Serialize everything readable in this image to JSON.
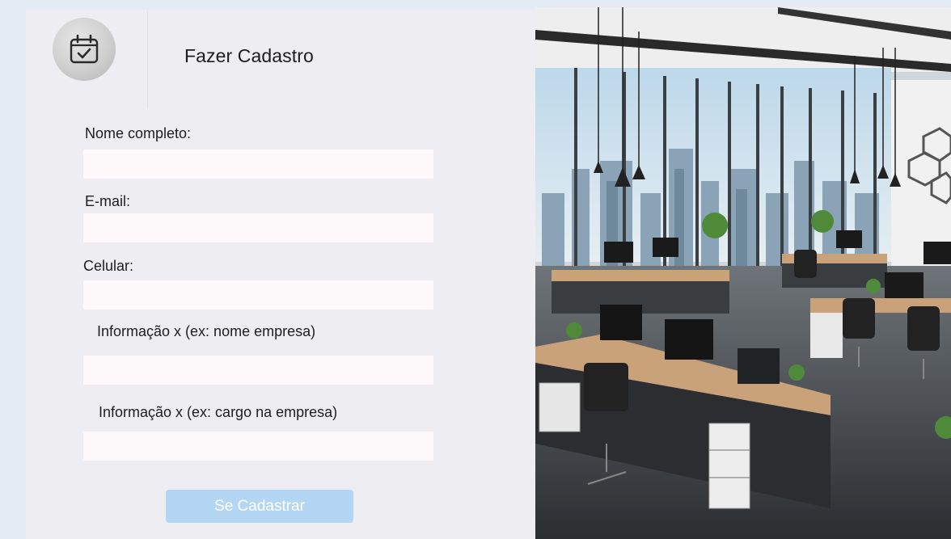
{
  "form": {
    "title": "Fazer Cadastro",
    "logo_icon": "calendar-check-icon",
    "fields": [
      {
        "label": "Nome completo:",
        "value": "",
        "placeholder": ""
      },
      {
        "label": "E-mail:",
        "value": "",
        "placeholder": ""
      },
      {
        "label": "Celular:",
        "value": "",
        "placeholder": ""
      },
      {
        "label": "Informação x (ex: nome empresa)",
        "value": "",
        "placeholder": ""
      },
      {
        "label": "Informação x (ex: cargo na empresa)",
        "value": "",
        "placeholder": ""
      }
    ],
    "submit_label": "Se Cadastrar"
  },
  "hero_image": {
    "subject": "modern open-plan office with desks, computers and city skyline through glass windows"
  },
  "colors": {
    "page_background": "#e3ebf4",
    "panel_background": "#ededf2",
    "input_background": "#fdf9fa",
    "button_background": "#b4d6f5",
    "button_text": "#ffffff"
  }
}
